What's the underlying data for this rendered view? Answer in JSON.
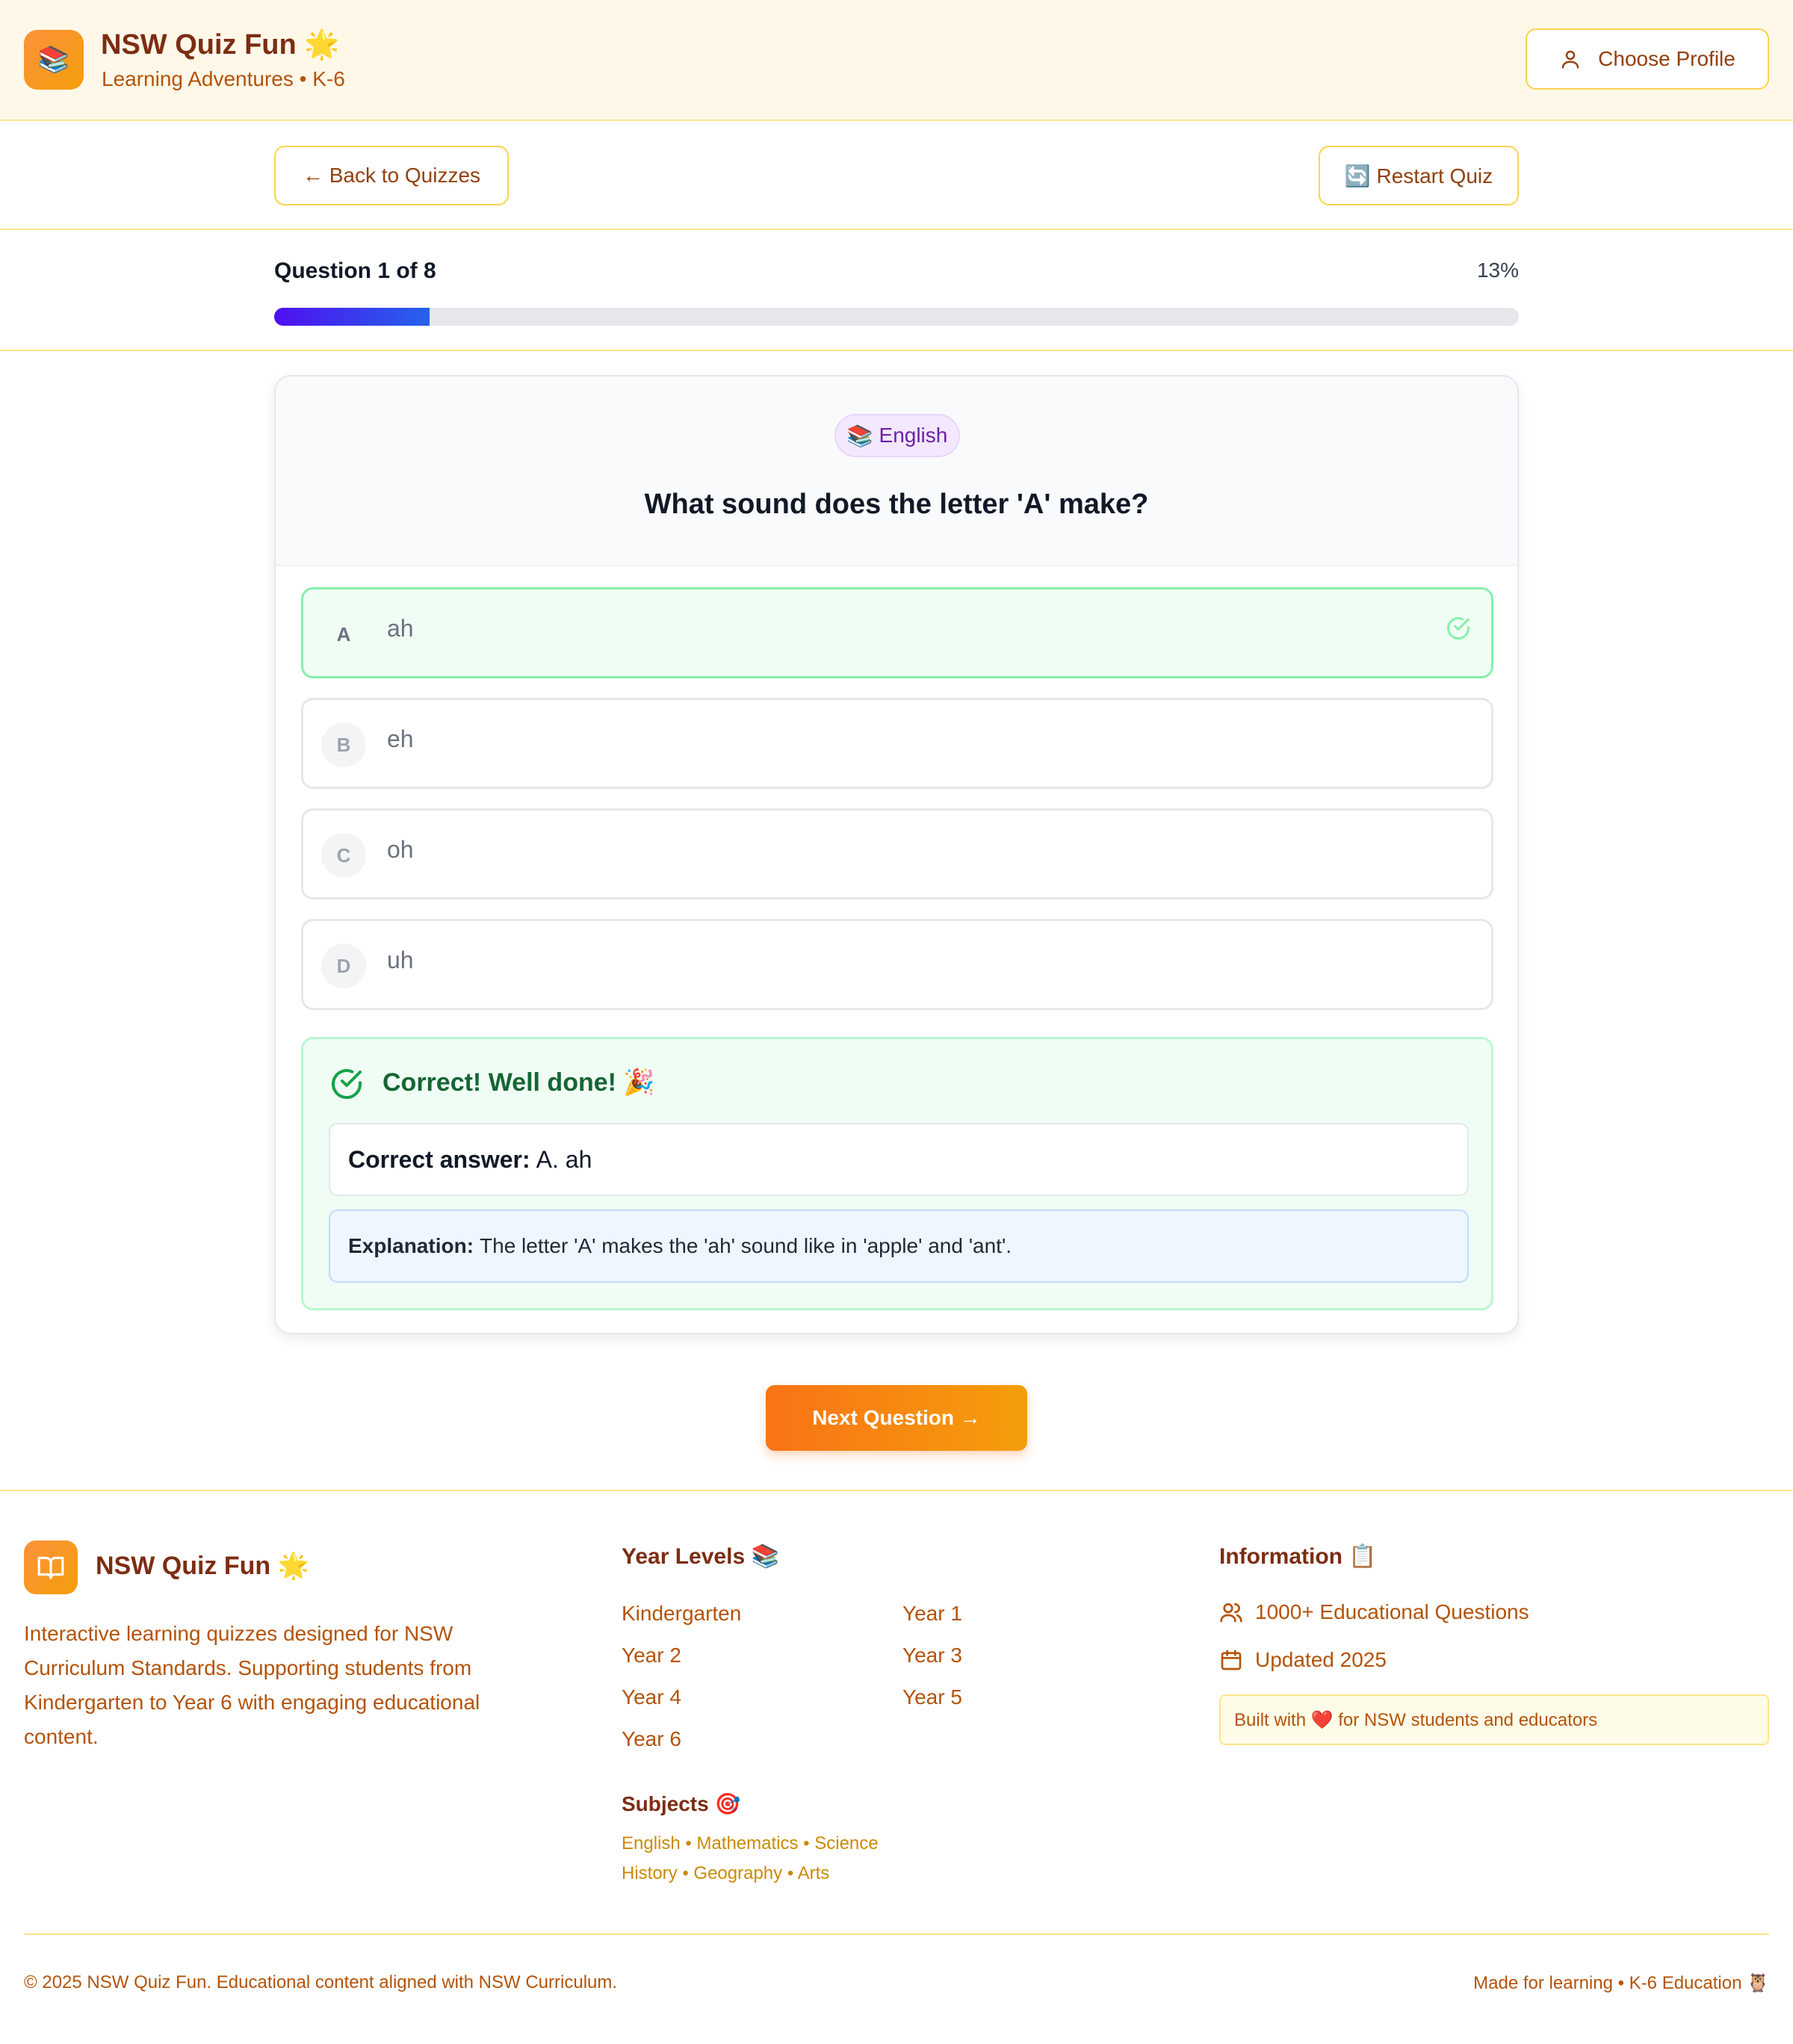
{
  "header": {
    "logo_emoji": "📚",
    "brand": "NSW Quiz Fun",
    "brand_emoji": "🌟",
    "tagline": "Learning Adventures • K-6",
    "profile_button": "Choose Profile"
  },
  "nav": {
    "back_label": "← Back to Quizzes",
    "restart_label": "🔄 Restart Quiz"
  },
  "progress": {
    "label": "Question 1 of 8",
    "percent_label": "13%",
    "fraction": 0.125
  },
  "question": {
    "subject_emoji": "📚",
    "subject": "English",
    "text": "What sound does the letter 'A' make?",
    "options": [
      {
        "letter": "A",
        "text": "ah",
        "correct": true
      },
      {
        "letter": "B",
        "text": "eh",
        "correct": false
      },
      {
        "letter": "C",
        "text": "oh",
        "correct": false
      },
      {
        "letter": "D",
        "text": "uh",
        "correct": false
      }
    ]
  },
  "feedback": {
    "title": "Correct! Well done! 🎉",
    "answer_label": "Correct answer:",
    "answer_value": "A. ah",
    "explanation_label": "Explanation:",
    "explanation_text": "The letter 'A' makes the 'ah' sound like in 'apple' and 'ant'."
  },
  "next_button": "Next Question →",
  "footer": {
    "brand": "NSW Quiz Fun",
    "brand_emoji": "🌟",
    "description": "Interactive learning quizzes designed for NSW Curriculum Standards. Supporting students from Kindergarten to Year 6 with engaging educational content.",
    "year_levels_title": "Year Levels 📚",
    "year_levels": [
      "Kindergarten",
      "Year 1",
      "Year 2",
      "Year 3",
      "Year 4",
      "Year 5",
      "Year 6"
    ],
    "subjects_title": "Subjects 🎯",
    "subjects_line1": "English • Mathematics • Science",
    "subjects_line2": "History • Geography • Arts",
    "info_title": "Information 📋",
    "info_questions": "1000+ Educational Questions",
    "info_updated": "Updated 2025",
    "built_with": "Built with ❤️ for NSW students and educators",
    "copyright": "© 2025 NSW Quiz Fun. Educational content aligned with NSW Curriculum.",
    "made_for": "Made for learning • K-6 Education 🦉"
  },
  "colors": {
    "accent_orange": "#f97316",
    "amber_border": "#fde68a",
    "correct_green": "#22c55e",
    "progress_blue": "#2563eb"
  }
}
